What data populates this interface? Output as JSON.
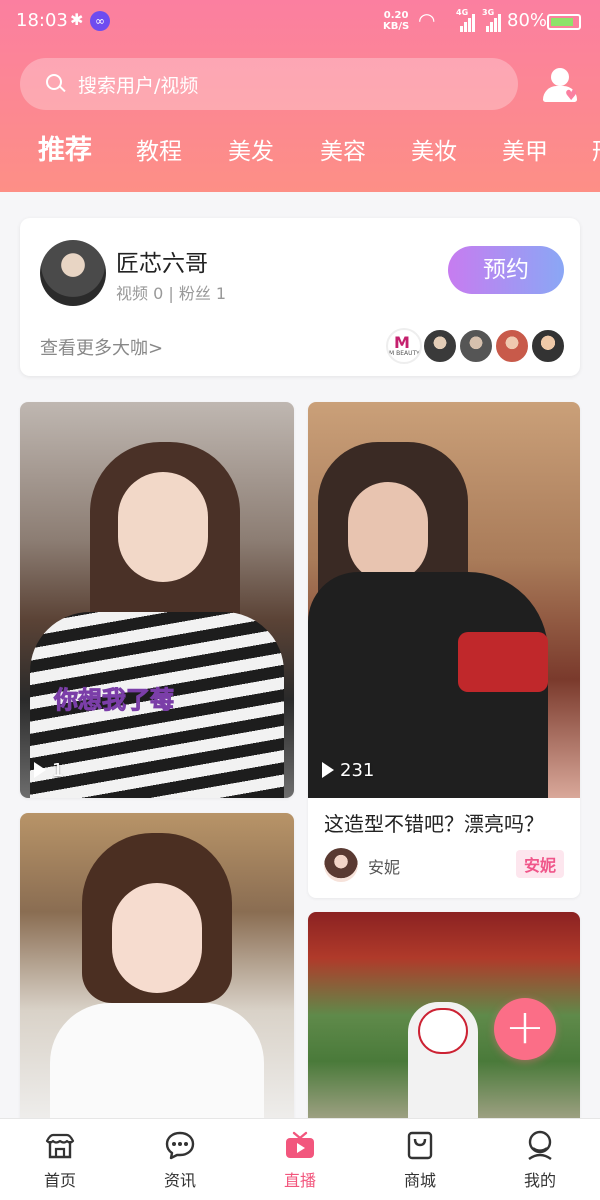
{
  "status_bar": {
    "time": "18:03",
    "network_speed_top": "0.20",
    "network_speed_bottom": "KB/S",
    "signal1_label": "4G",
    "signal2_label": "3G",
    "battery": "80%"
  },
  "header": {
    "search_placeholder": "搜索用户/视频",
    "tabs": [
      {
        "label": "推荐",
        "active": true
      },
      {
        "label": "教程",
        "active": false
      },
      {
        "label": "美发",
        "active": false
      },
      {
        "label": "美容",
        "active": false
      },
      {
        "label": "美妆",
        "active": false
      },
      {
        "label": "美甲",
        "active": false
      },
      {
        "label": "形",
        "active": false
      }
    ]
  },
  "recommend_card": {
    "name": "匠芯六哥",
    "meta": "视频 0 | 粉丝 1",
    "button_label": "预约",
    "more_link": "查看更多大咖>",
    "thumb_text": "M BEAUTY"
  },
  "videos": [
    {
      "plays": "1",
      "overlay_text": "你想我了莓"
    },
    {
      "plays": "231",
      "caption": "这造型不错吧？漂亮吗？",
      "author": "安妮",
      "tag": "安妮"
    },
    {},
    {}
  ],
  "fab_symbol": "+",
  "bottom_nav": [
    {
      "label": "首页",
      "icon": "home-icon",
      "active": false
    },
    {
      "label": "资讯",
      "icon": "chat-icon",
      "active": false
    },
    {
      "label": "直播",
      "icon": "live-video-icon",
      "active": true
    },
    {
      "label": "商城",
      "icon": "shopping-bag-icon",
      "active": false
    },
    {
      "label": "我的",
      "icon": "profile-icon",
      "active": false
    }
  ],
  "colors": {
    "header_top": "#fb7fa0",
    "header_bottom": "#fd8f86",
    "accent": "#f2567d",
    "fab": "#fb6e87",
    "tag_text": "#f0568a"
  }
}
